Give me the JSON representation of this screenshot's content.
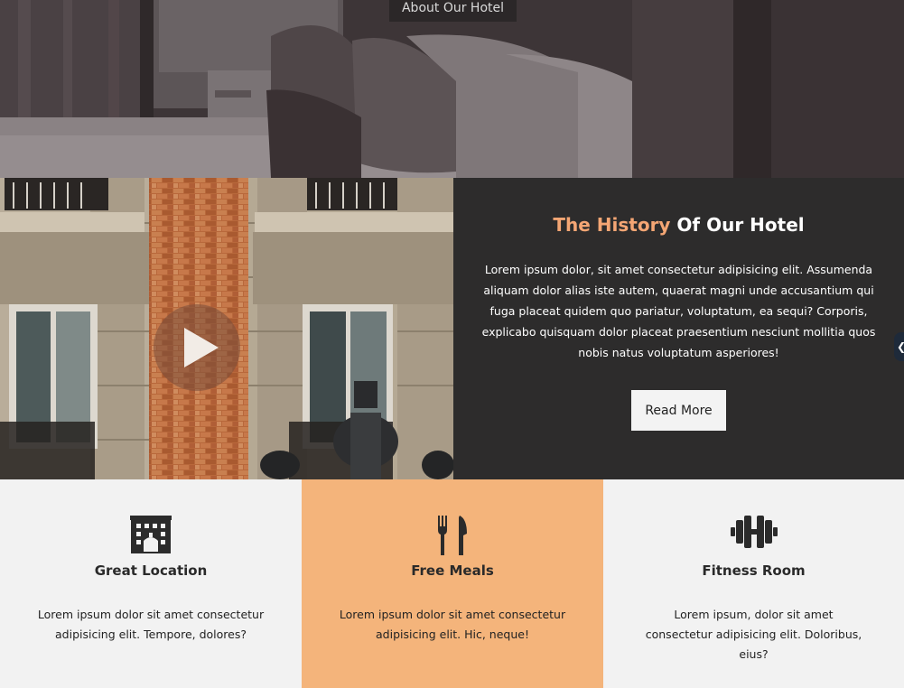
{
  "hero": {
    "about_button_label": "About Our Hotel"
  },
  "history": {
    "title_accent": "The History",
    "title_rest": " Of Our Hotel",
    "body": "Lorem ipsum dolor, sit amet consectetur adipisicing elit. Assumenda aliquam dolor alias iste autem, quaerat magni unde accusantium qui fuga placeat quidem quo pariatur, voluptatum, ea sequi? Corporis, explicabo quisquam dolor placeat praesentium nesciunt mollitia quos nobis natus voluptatum asperiores!",
    "read_more_label": "Read More",
    "play_icon": "play-icon"
  },
  "features": [
    {
      "icon": "hotel-building-icon",
      "title": "Great Location",
      "text": "Lorem ipsum dolor sit amet consectetur adipisicing elit. Tempore, dolores?"
    },
    {
      "icon": "utensils-icon",
      "title": "Free Meals",
      "text": "Lorem ipsum dolor sit amet consectetur adipisicing elit. Hic, neque!"
    },
    {
      "icon": "dumbbell-icon",
      "title": "Fitness Room",
      "text": "Lorem ipsum, dolor sit amet consectetur adipisicing elit. Doloribus, eius?"
    }
  ],
  "colors": {
    "accent": "#f4a674",
    "feature_highlight": "#f4b47b",
    "dark_panel": "#2d2c2c"
  }
}
